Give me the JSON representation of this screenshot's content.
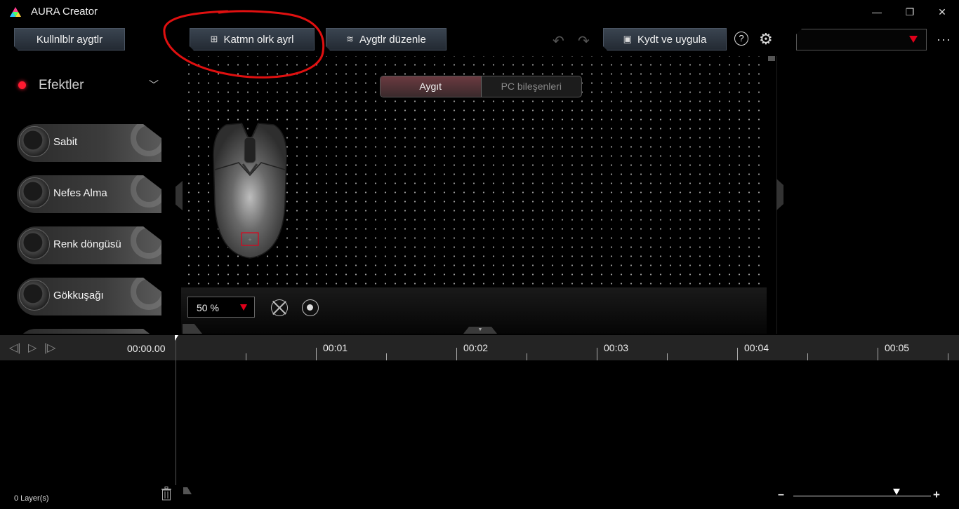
{
  "window": {
    "title": "AURA Creator",
    "controls": {
      "minimize": "—",
      "maximize": "❐",
      "close": "✕"
    }
  },
  "toolbar": {
    "available_devices": "Kullnlblr aygtlr",
    "separate_layers": "Katmn olrk ayrl",
    "edit_devices": "Aygtlr düzenle",
    "save_apply": "Kydt ve uygula",
    "help_glyph": "?",
    "more_glyph": "···",
    "profile_value": ""
  },
  "effects": {
    "title": "Efektler",
    "items": [
      {
        "label": "Sabit",
        "icon": "static-effect-icon"
      },
      {
        "label": "Nefes Alma",
        "icon": "breathing-effect-icon"
      },
      {
        "label": "Renk döngüsü",
        "icon": "color-cycle-effect-icon"
      },
      {
        "label": "Gökkuşağı",
        "icon": "rainbow-effect-icon"
      }
    ]
  },
  "canvas": {
    "tabs": [
      {
        "label": "Aygıt",
        "active": true
      },
      {
        "label": "PC bileşenleri",
        "active": false
      }
    ],
    "zoom": "50 %"
  },
  "timeline": {
    "current_time": "00:00.00",
    "ticks": [
      "00:01",
      "00:02",
      "00:03",
      "00:04",
      "00:05"
    ],
    "layers": "0  Layer(s)",
    "zoom_minus": "–",
    "zoom_plus": "+"
  },
  "colors": {
    "accent_red": "#e0001a",
    "annotation_red": "#e01010"
  }
}
